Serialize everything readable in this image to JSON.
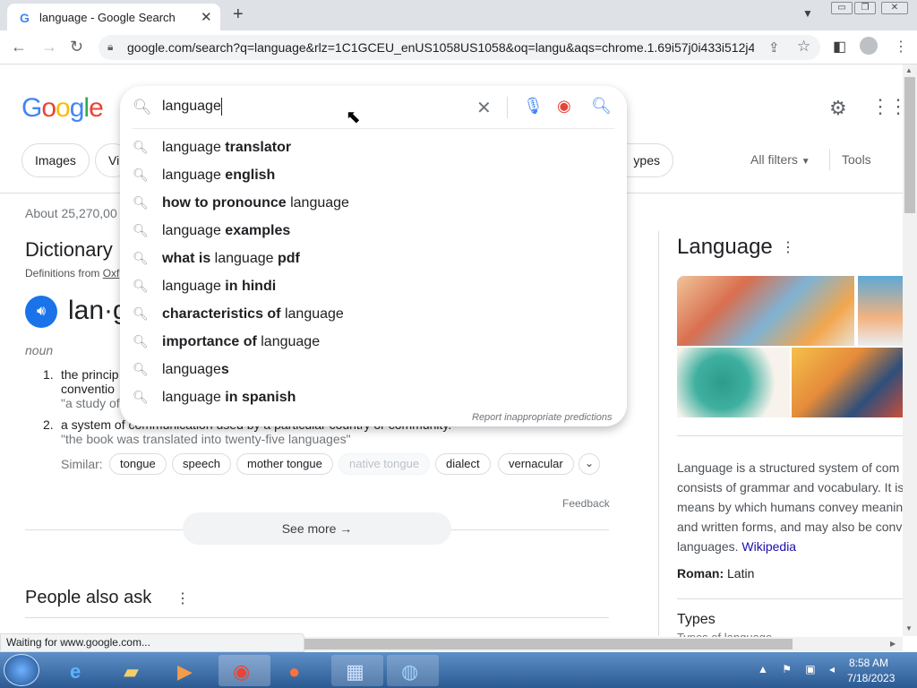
{
  "browser": {
    "tab_title": "language - Google Search",
    "tab_favicon": "G",
    "tab_close": "✕",
    "new_tab": "+",
    "tab_dropdown": "⌄",
    "window_controls": [
      "▭",
      "❐",
      "✕"
    ],
    "url": "google.com/search?q=language&rlz=1C1GCEU_enUS1058US1058&oq=langu&aqs=chrome.1.69i57j0i433i512j4...",
    "icons": {
      "back": "arrow-left-icon",
      "forward": "arrow-right-icon",
      "reload": "reload-icon",
      "lock": "lock-icon",
      "share": "share-icon",
      "star": "star-icon",
      "sidepanel": "side-panel-icon",
      "profile": "profile-icon",
      "menu": "more-vert-icon"
    }
  },
  "google": {
    "logo": "Google",
    "filters": [
      "Images",
      "Vi",
      "ypes"
    ],
    "all_filters": "All filters",
    "tools": "Tools",
    "result_stats": "About 25,270,00"
  },
  "dictionary": {
    "title": "Dictionary",
    "definitions_from": "Definitions from",
    "definitions_source": "Oxf",
    "word": "lan·g",
    "part_of_speech": "noun",
    "definitions": [
      {
        "num": "1.",
        "text": "the princip",
        "text2": "conventio",
        "example": "\"a study of"
      },
      {
        "num": "2.",
        "text": "a system of communication used by a particular country or community.",
        "example": "\"the book was translated into twenty-five languages\""
      }
    ],
    "similar_label": "Similar:",
    "similar": [
      "tongue",
      "speech",
      "mother tongue",
      "native tongue",
      "dialect",
      "vernacular"
    ],
    "feedback": "Feedback",
    "see_more": "See more",
    "see_more_arrow": "→"
  },
  "people_also_ask": {
    "title": "People also ask"
  },
  "knowledge_panel": {
    "title": "Language",
    "description_lines": [
      "Language is a structured system of com",
      "consists of grammar and vocabulary. It is",
      "means by which humans convey meanin",
      "and written forms, and may also be conv",
      "languages."
    ],
    "wiki_link": "Wikipedia",
    "roman_label": "Roman:",
    "roman_value": "Latin",
    "types_title": "Types",
    "types_sub": "Types of language"
  },
  "search_box": {
    "query": "language",
    "suggestions": [
      {
        "plain": "language ",
        "bold": "translator",
        "order": "pb"
      },
      {
        "plain": "language ",
        "bold": "english",
        "order": "pb"
      },
      {
        "plain": " language",
        "bold": "how to pronounce",
        "order": "bp"
      },
      {
        "plain": "language ",
        "bold": "examples",
        "order": "pb"
      },
      {
        "plain": " language ",
        "bold": "what is",
        "bold2": "pdf",
        "order": "bpb"
      },
      {
        "plain": "language ",
        "bold": "in hindi",
        "order": "pb"
      },
      {
        "plain": " language",
        "bold": "characteristics of",
        "order": "bp"
      },
      {
        "plain": " language",
        "bold": "importance of",
        "order": "bp"
      },
      {
        "plain": "language",
        "bold": "s",
        "order": "pb"
      },
      {
        "plain": "language ",
        "bold": "in spanish",
        "order": "pb"
      }
    ],
    "report": "Report inappropriate predictions"
  },
  "status_bar": "Waiting for www.google.com...",
  "taskbar": {
    "time": "8:58 AM",
    "date": "7/18/2023",
    "tray_icons": "▲ ⚑ ▣ ◂"
  }
}
